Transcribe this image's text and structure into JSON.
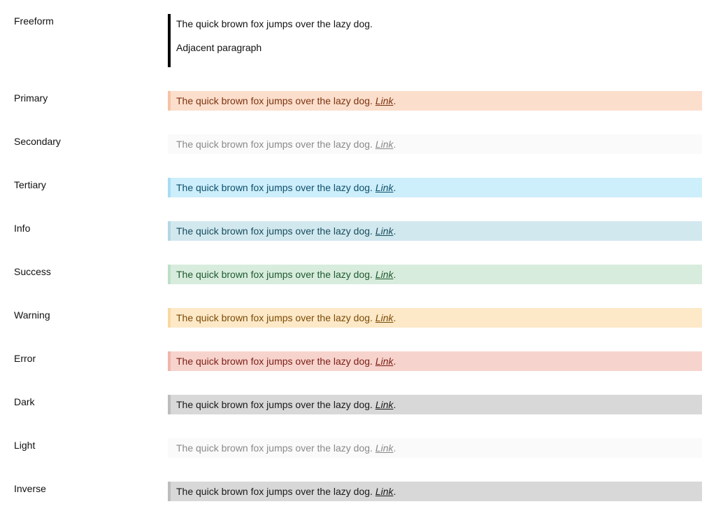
{
  "freeform": {
    "label": "Freeform",
    "paragraphs": [
      "The quick brown fox jumps over the lazy dog.",
      "Adjacent paragraph"
    ]
  },
  "rows": [
    {
      "label": "Primary",
      "text": "The quick brown fox jumps over the lazy dog.",
      "link": "Link",
      "after": ".",
      "bg": "#fcdecc",
      "border": "#f6c3a6",
      "color": "#7a3410"
    },
    {
      "label": "Secondary",
      "text": "The quick brown fox jumps over the lazy dog.",
      "link": "Link",
      "after": ".",
      "bg": "#fafafa",
      "border": "#fafafa",
      "color": "#8a8a8a"
    },
    {
      "label": "Tertiary",
      "text": "The quick brown fox jumps over the lazy dog.",
      "link": "Link",
      "after": ".",
      "bg": "#cdeefb",
      "border": "#a8ddf3",
      "color": "#0e4f6b"
    },
    {
      "label": "Info",
      "text": "The quick brown fox jumps over the lazy dog.",
      "link": "Link",
      "after": ".",
      "bg": "#d2e8ef",
      "border": "#b3d7e3",
      "color": "#174d5d"
    },
    {
      "label": "Success",
      "text": "The quick brown fox jumps over the lazy dog.",
      "link": "Link",
      "after": ".",
      "bg": "#d8ecdd",
      "border": "#bfdfc8",
      "color": "#1e5a2f"
    },
    {
      "label": "Warning",
      "text": "The quick brown fox jumps over the lazy dog.",
      "link": "Link",
      "after": ".",
      "bg": "#fde9c8",
      "border": "#f8d8a2",
      "color": "#7a4a06"
    },
    {
      "label": "Error",
      "text": "The quick brown fox jumps over the lazy dog.",
      "link": "Link",
      "after": ".",
      "bg": "#f7d3cd",
      "border": "#efb5ab",
      "color": "#7a1e14"
    },
    {
      "label": "Dark",
      "text": "The quick brown fox jumps over the lazy dog.",
      "link": "Link",
      "after": ".",
      "bg": "#d8d8d8",
      "border": "#bdbdbd",
      "color": "#1a1a1a"
    },
    {
      "label": "Light",
      "text": "The quick brown fox jumps over the lazy dog.",
      "link": "Link",
      "after": ".",
      "bg": "#fafafa",
      "border": "#fafafa",
      "color": "#8a8a8a"
    },
    {
      "label": "Inverse",
      "text": "The quick brown fox jumps over the lazy dog.",
      "link": "Link",
      "after": ".",
      "bg": "#d8d8d8",
      "border": "#bdbdbd",
      "color": "#1a1a1a"
    }
  ]
}
